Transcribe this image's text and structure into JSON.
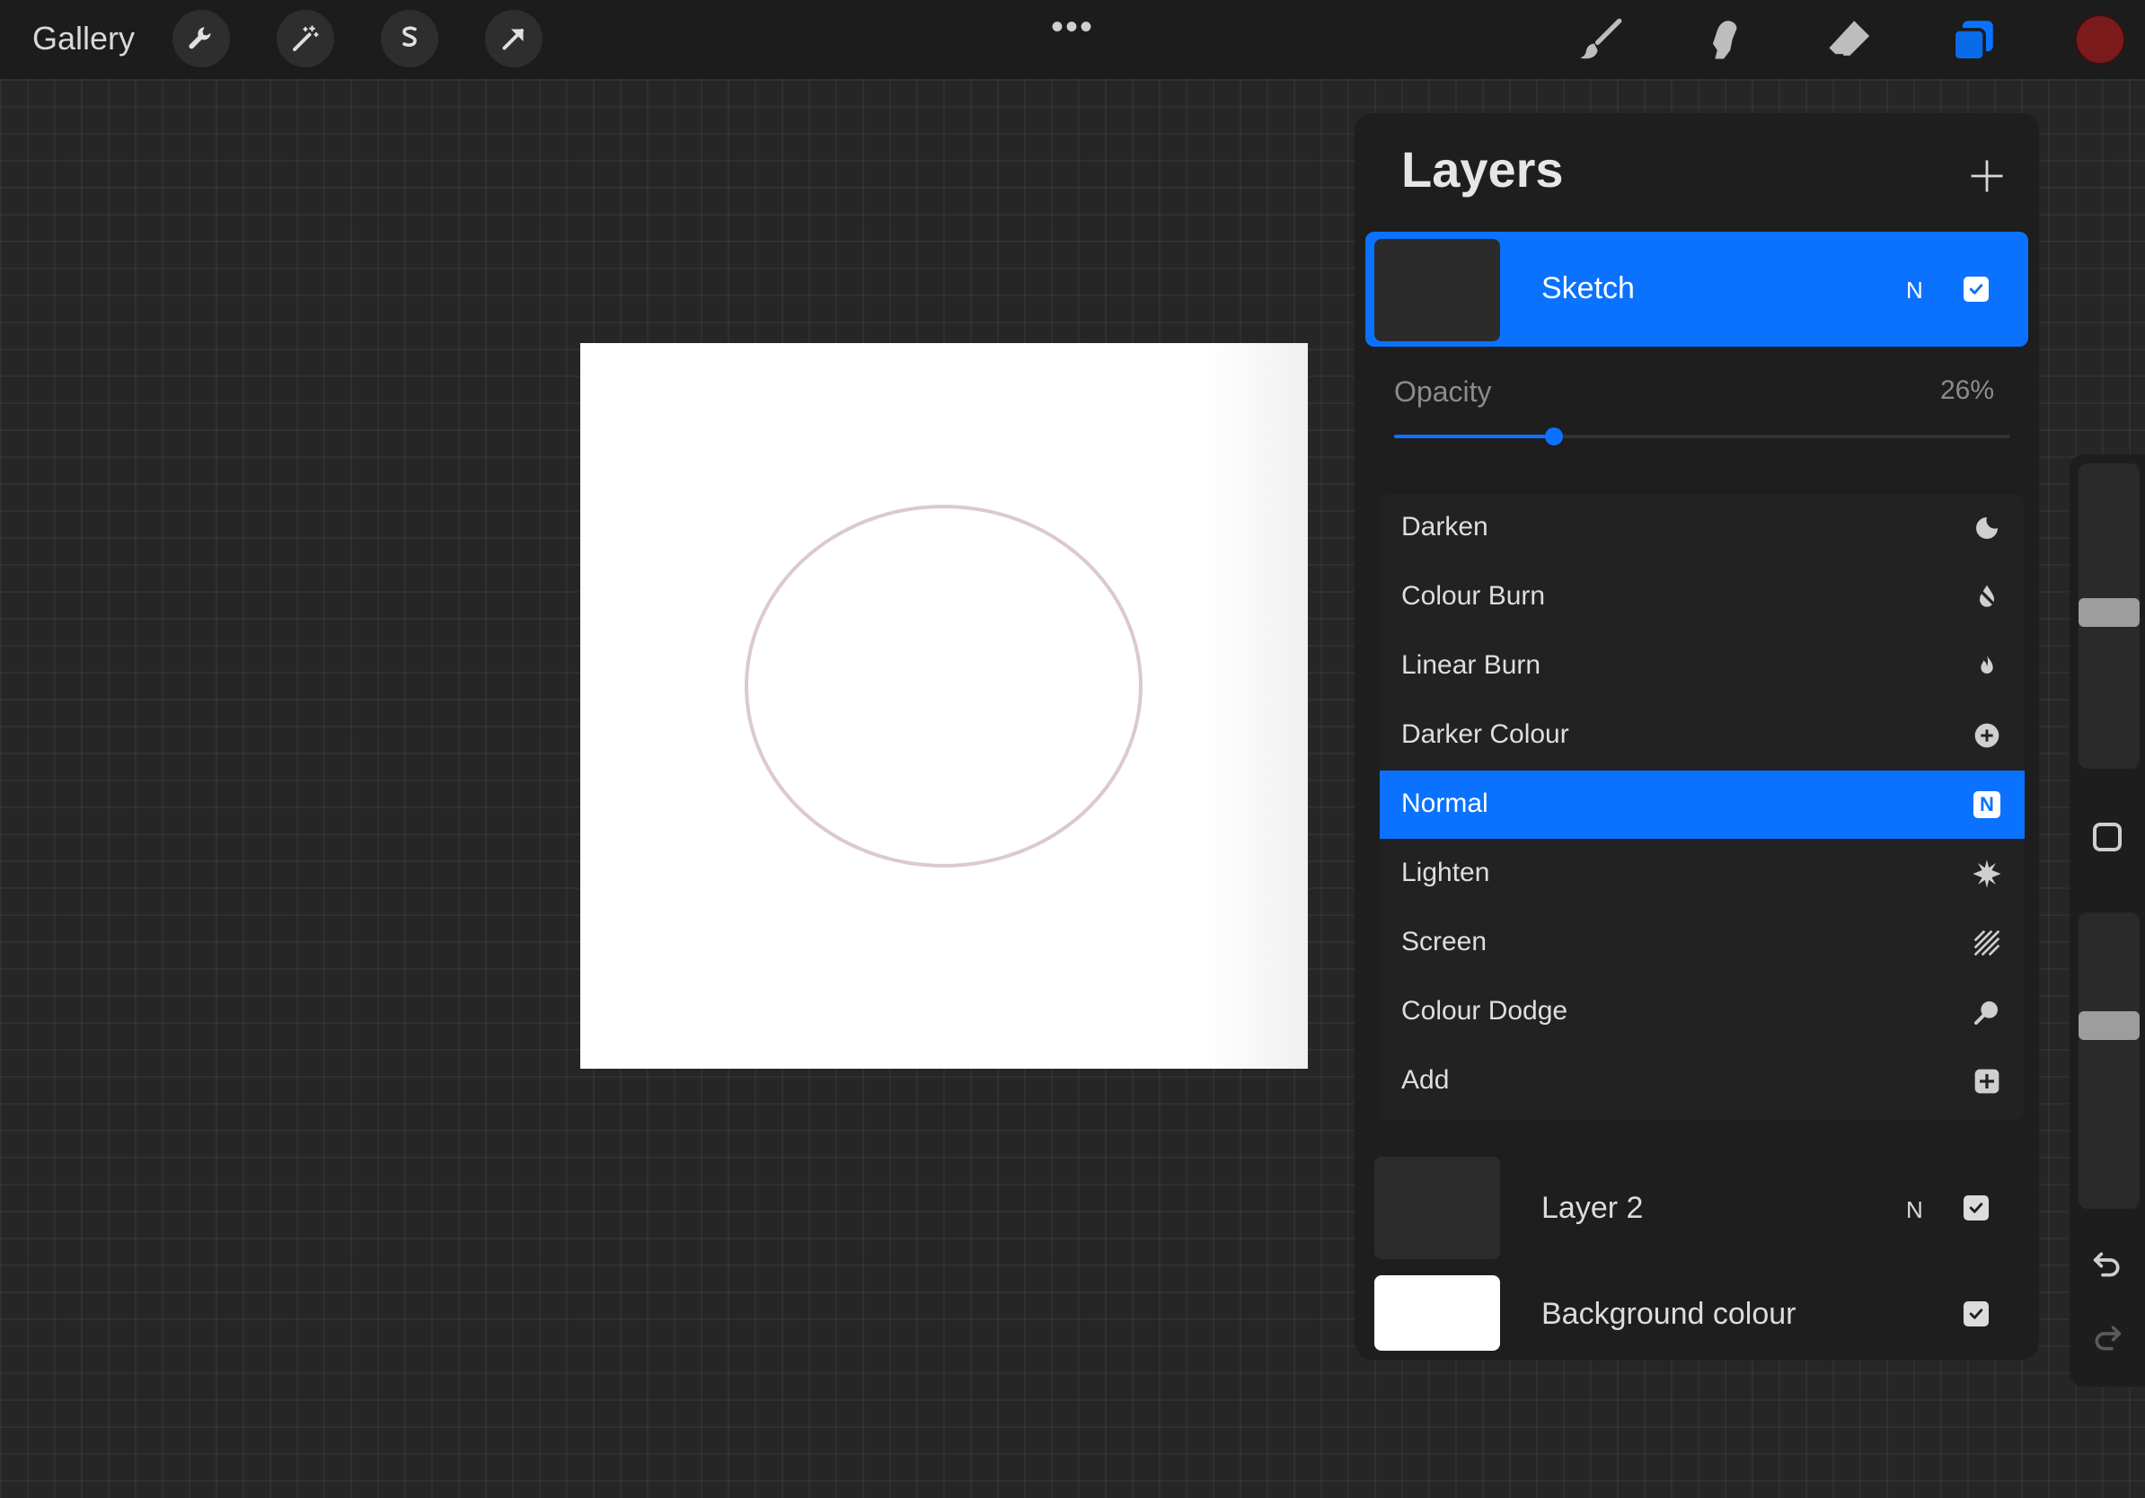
{
  "topbar": {
    "gallery_label": "Gallery",
    "left_tools": [
      "wrench-icon",
      "magic-wand-icon",
      "selection-s-icon",
      "transform-arrow-icon"
    ],
    "more_label": "•••",
    "right_tools": [
      "brush-icon",
      "smudge-icon",
      "eraser-icon",
      "layers-icon"
    ],
    "active_color": "#7b1b1b"
  },
  "canvas": {
    "background": "#ffffff",
    "sketch_stroke": "#dccaca"
  },
  "layers_panel": {
    "title": "Layers",
    "add_icon": "plus-icon",
    "layers": [
      {
        "name": "Sketch",
        "mode": "N",
        "visible": true,
        "active": true
      },
      {
        "name": "Layer 2",
        "mode": "N",
        "visible": true,
        "active": false
      },
      {
        "name": "Background colour",
        "mode": "",
        "visible": true,
        "active": false
      }
    ],
    "opacity": {
      "label": "Opacity",
      "value_text": "26%",
      "value": 0.26
    },
    "blend_modes": [
      {
        "label": "Darken",
        "icon": "moon-icon"
      },
      {
        "label": "Colour Burn",
        "icon": "burn-drop-icon"
      },
      {
        "label": "Linear Burn",
        "icon": "flame-icon"
      },
      {
        "label": "Darker Colour",
        "icon": "plus-circle-icon"
      },
      {
        "label": "Normal",
        "icon": "n-badge-icon",
        "icon_text": "N",
        "selected": true
      },
      {
        "label": "Lighten",
        "icon": "sparkle-icon"
      },
      {
        "label": "Screen",
        "icon": "hatch-icon"
      },
      {
        "label": "Colour Dodge",
        "icon": "magnifier-icon"
      },
      {
        "label": "Add",
        "icon": "plus-square-icon"
      }
    ]
  },
  "side_rail": {
    "brush_size_level": 0.45,
    "opacity_level": 0.35,
    "modify_icon": "square-icon",
    "undo_icon": "undo-icon",
    "redo_icon": "redo-icon"
  },
  "colors": {
    "accent": "#0a72ff"
  }
}
